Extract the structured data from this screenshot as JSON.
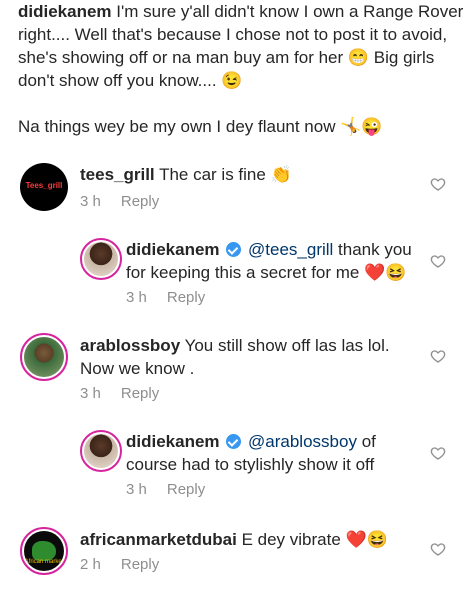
{
  "caption": {
    "username": "didiekanem",
    "text1": "I'm sure y'all didn't know I own a Range Rover right.... Well that's because I chose not to post it to avoid, she's showing off or na man buy am for her 😁 Big girls don't show off you know.... 😉",
    "text2": "Na things wey be my own I dey flaunt now 🤸😜"
  },
  "comments": [
    {
      "username": "tees_grill",
      "text": "The car is fine 👏",
      "time": "3 h",
      "reply": "Reply",
      "avatar_label": "Tees_grill"
    },
    {
      "username": "didiekanem",
      "mention": "@tees_grill",
      "text": "thank you for keeping this a secret for me ❤️😆",
      "time": "3 h",
      "reply": "Reply"
    },
    {
      "username": "arablossboy",
      "text": "You still show off las las lol. Now we know .",
      "time": "3 h",
      "reply": "Reply"
    },
    {
      "username": "didiekanem",
      "mention": "@arablossboy",
      "text": "of course had to stylishly show it off",
      "time": "3 h",
      "reply": "Reply"
    },
    {
      "username": "africanmarketdubai",
      "text": "E dey vibrate ❤️😆",
      "time": "2 h",
      "reply": "Reply",
      "avatar_label": "African market"
    }
  ],
  "icons": {
    "like": "heart-outline-icon",
    "verified": "verified-badge-icon"
  },
  "colors": {
    "text": "#262626",
    "muted": "#8e8e8e",
    "mention": "#00376b",
    "verified": "#3897f0"
  }
}
